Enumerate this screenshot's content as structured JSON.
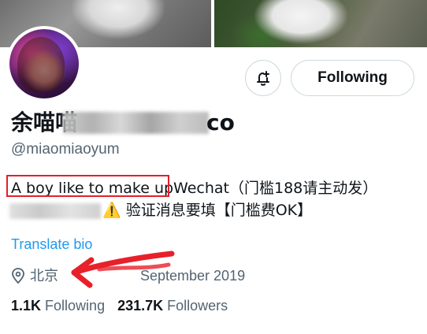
{
  "profile": {
    "display_name_visible": "余喵喵",
    "display_name_tail": "co",
    "handle": "@miaomiaoyum",
    "follow_button": "Following",
    "bio_highlight": "A boy like to make up",
    "bio_rest_line1": "Wechat（门槛188请主动发）",
    "bio_line2": "验证消息要填【门槛费OK】",
    "translate_bio": "Translate bio",
    "location": "北京",
    "joined_tail": "September 2019",
    "following_count": "1.1K",
    "following_label": "Following",
    "followers_count": "231.7K",
    "followers_label": "Followers"
  },
  "icons": {
    "bell": "notification-bell-plus-icon",
    "location": "location-pin-icon",
    "warning": "warning-sign-icon",
    "annotation": "red-arrow-annotation"
  },
  "colors": {
    "link_blue": "#1d9bf0",
    "secondary_text": "#536471",
    "highlight_red": "#e0202a",
    "arrow_red": "#e8202a"
  }
}
